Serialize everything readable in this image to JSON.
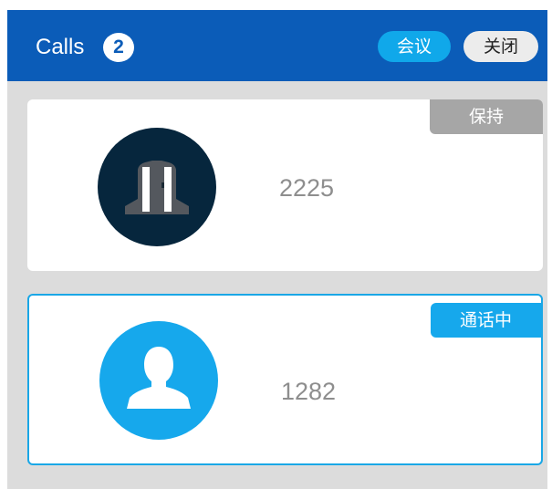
{
  "header": {
    "title": "Calls",
    "count": "2",
    "conference_label": "会议",
    "close_label": "关闭"
  },
  "calls": [
    {
      "number": "2225",
      "status": "保持",
      "avatar_icon": "building-icon"
    },
    {
      "number": "1282",
      "status": "通话中",
      "avatar_icon": "user-icon"
    }
  ],
  "colors": {
    "header": "#0b5cb8",
    "accent": "#16a8ec",
    "hold_badge": "#a6a6a6",
    "dark_avatar": "#06263d"
  }
}
